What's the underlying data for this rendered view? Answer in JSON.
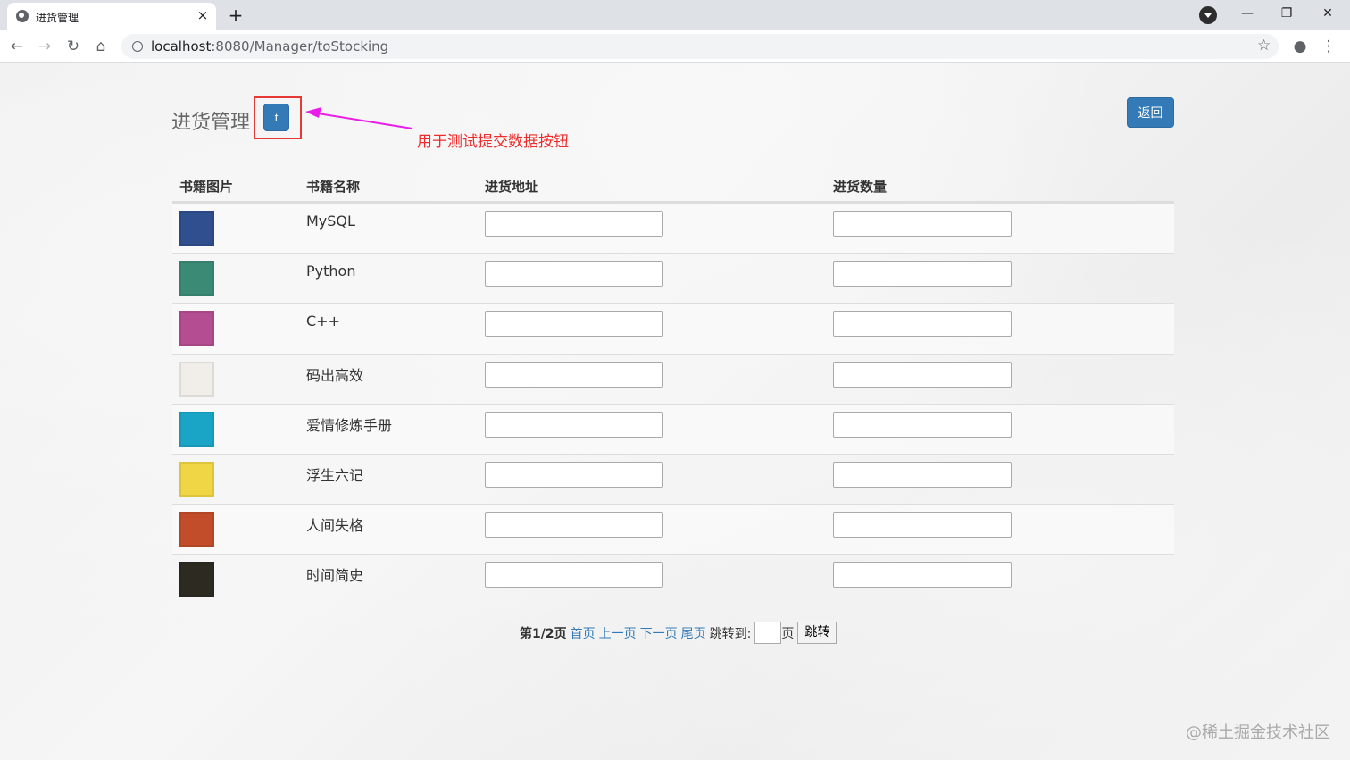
{
  "browser": {
    "tab_title": "进货管理",
    "tab_close": "×",
    "new_tab": "+",
    "url_host": "localhost",
    "url_rest": ":8080/Manager/toStocking",
    "window_controls": {
      "minimize": "—",
      "maximize": "❐",
      "close": "✕"
    }
  },
  "page": {
    "title": "进货管理",
    "test_button": "t",
    "annotation": "用于测试提交数据按钮",
    "back_button": "返回"
  },
  "table": {
    "headers": [
      "书籍图片",
      "书籍名称",
      "进货地址",
      "进货数量"
    ],
    "rows": [
      {
        "name": "MySQL",
        "cover_color": "#2f4f8f",
        "address": "",
        "quantity": ""
      },
      {
        "name": "Python",
        "cover_color": "#3b8a76",
        "address": "",
        "quantity": ""
      },
      {
        "name": "C++",
        "cover_color": "#b54d93",
        "address": "",
        "quantity": ""
      },
      {
        "name": "码出高效",
        "cover_color": "#f1eeea",
        "address": "",
        "quantity": ""
      },
      {
        "name": "爱情修炼手册",
        "cover_color": "#1aa5c7",
        "address": "",
        "quantity": ""
      },
      {
        "name": "浮生六记",
        "cover_color": "#f0d545",
        "address": "",
        "quantity": ""
      },
      {
        "name": "人间失格",
        "cover_color": "#c24d2a",
        "address": "",
        "quantity": ""
      },
      {
        "name": "时间简史",
        "cover_color": "#2d2a22",
        "address": "",
        "quantity": ""
      }
    ]
  },
  "pager": {
    "page_info": "第1/2页",
    "first": "首页",
    "prev": "上一页",
    "next": "下一页",
    "last": "尾页",
    "jump_label": "跳转到:",
    "jump_value": "",
    "page_suffix": "页",
    "jump_button": "跳转"
  },
  "watermark": "@稀土掘金技术社区",
  "colors": {
    "primary": "#337ab7",
    "annotation_red": "#ee2b2b",
    "arrow_magenta": "#e81ee8"
  }
}
